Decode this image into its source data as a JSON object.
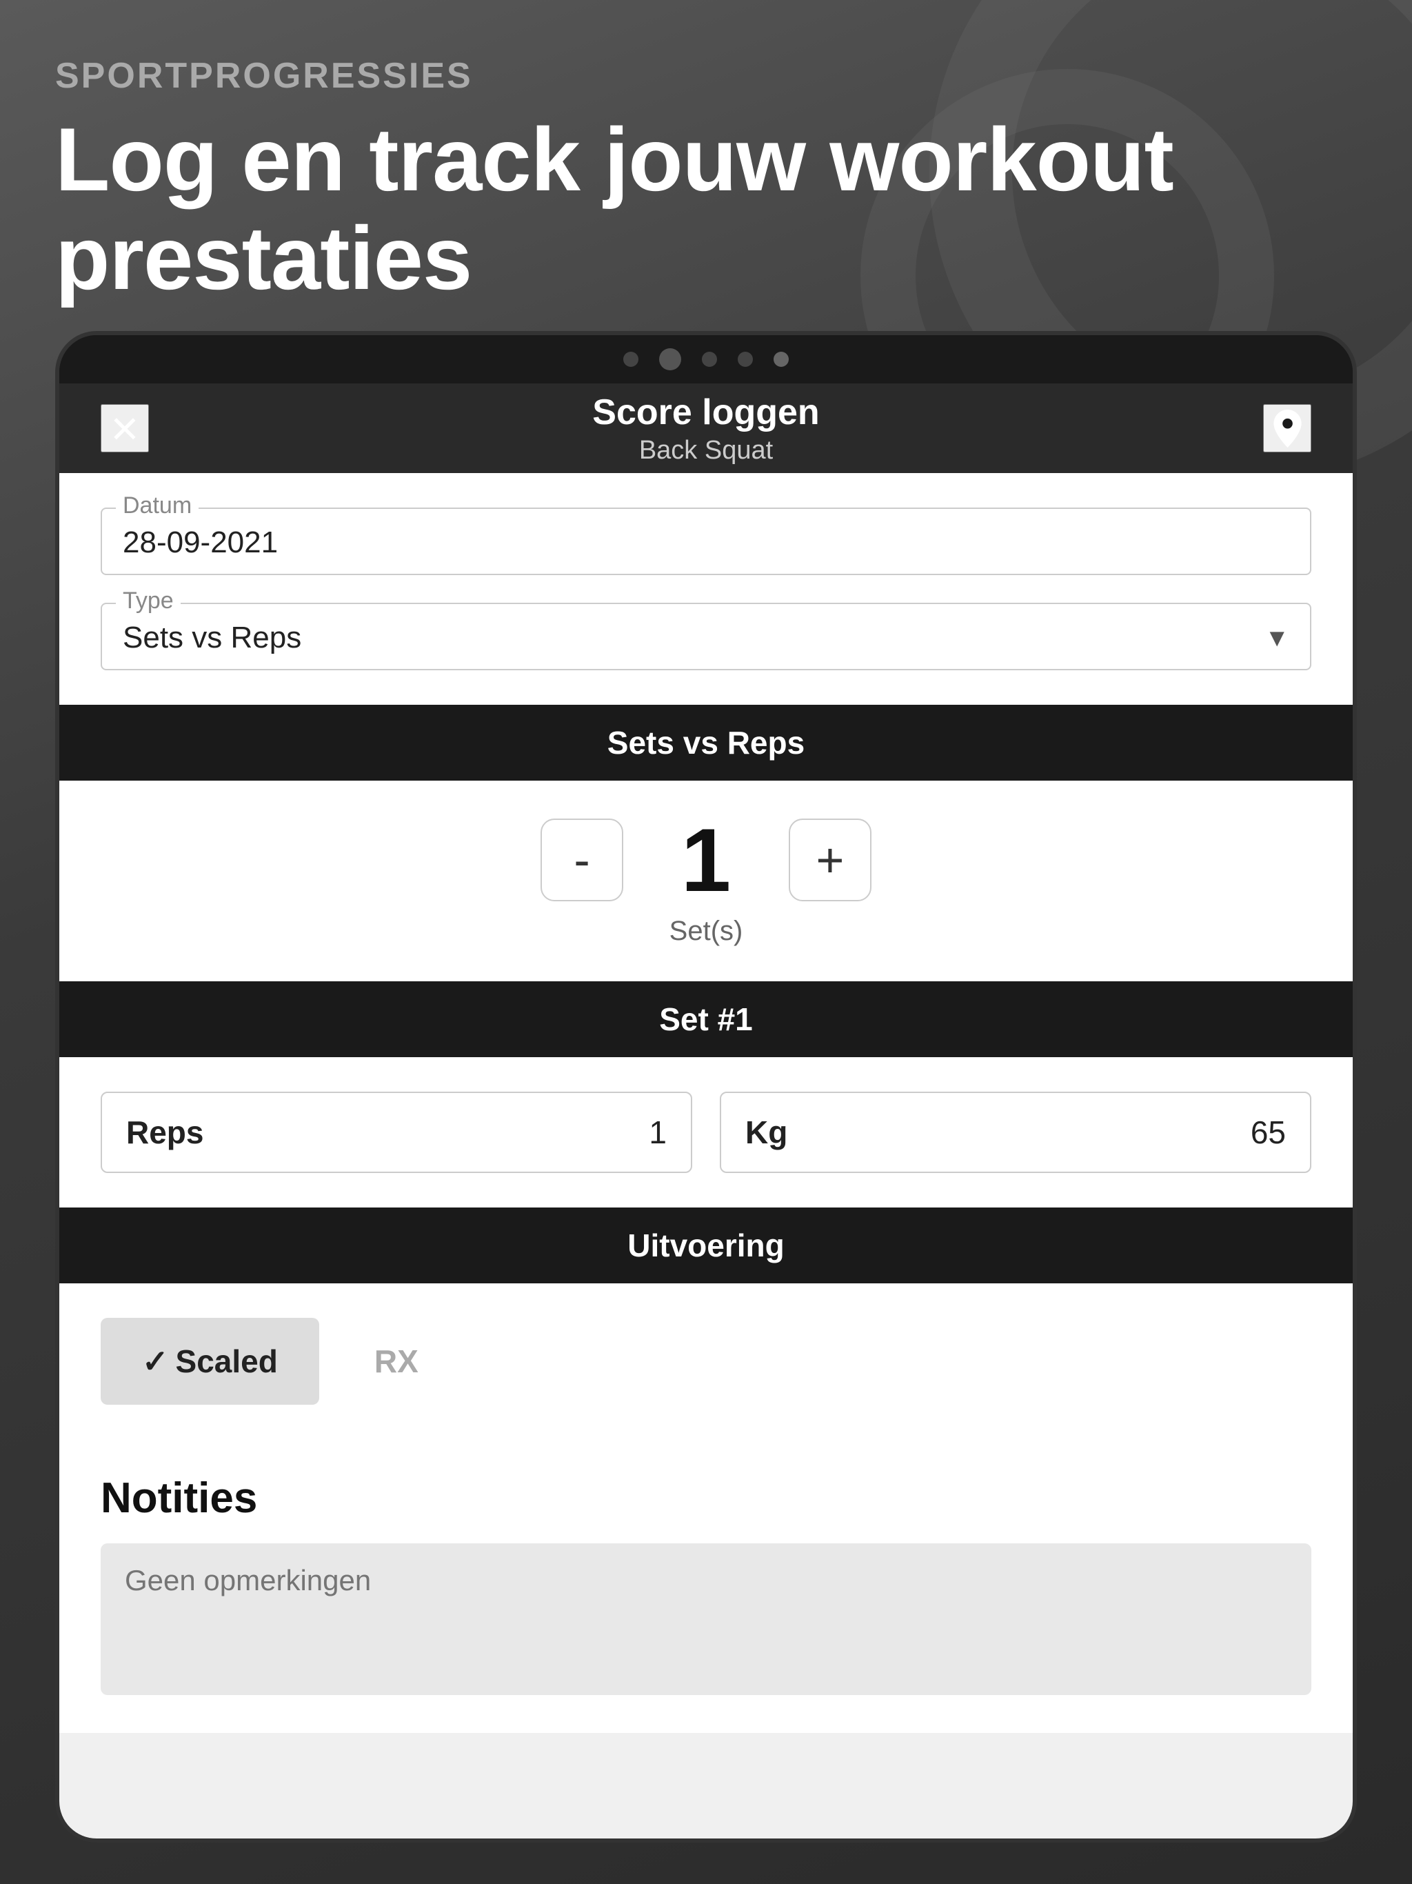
{
  "background": {
    "subtitle": "SPORTPROGRESSIES",
    "title": "Log en track jouw workout prestaties"
  },
  "camera_dots": [
    {
      "type": "small",
      "active": false
    },
    {
      "type": "large",
      "active": true
    },
    {
      "type": "small",
      "active": false
    },
    {
      "type": "small",
      "active": false
    },
    {
      "type": "small",
      "active": true
    }
  ],
  "navbar": {
    "close_icon": "×",
    "title": "Score loggen",
    "subtitle": "Back Squat",
    "location_icon": "📍"
  },
  "form": {
    "datum_label": "Datum",
    "datum_value": "28-09-2021",
    "type_label": "Type",
    "type_value": "Sets vs Reps"
  },
  "sets_section": {
    "header": "Sets vs Reps",
    "minus_label": "-",
    "plus_label": "+",
    "count": "1",
    "unit": "Set(s)"
  },
  "set1_section": {
    "header": "Set #1",
    "reps_label": "Reps",
    "reps_value": "1",
    "kg_label": "Kg",
    "kg_value": "65"
  },
  "uitvoering_section": {
    "header": "Uitvoering",
    "scaled_label": "Scaled",
    "rx_label": "RX",
    "active": "scaled"
  },
  "notities_section": {
    "title": "Notities",
    "placeholder": "Geen opmerkingen"
  }
}
